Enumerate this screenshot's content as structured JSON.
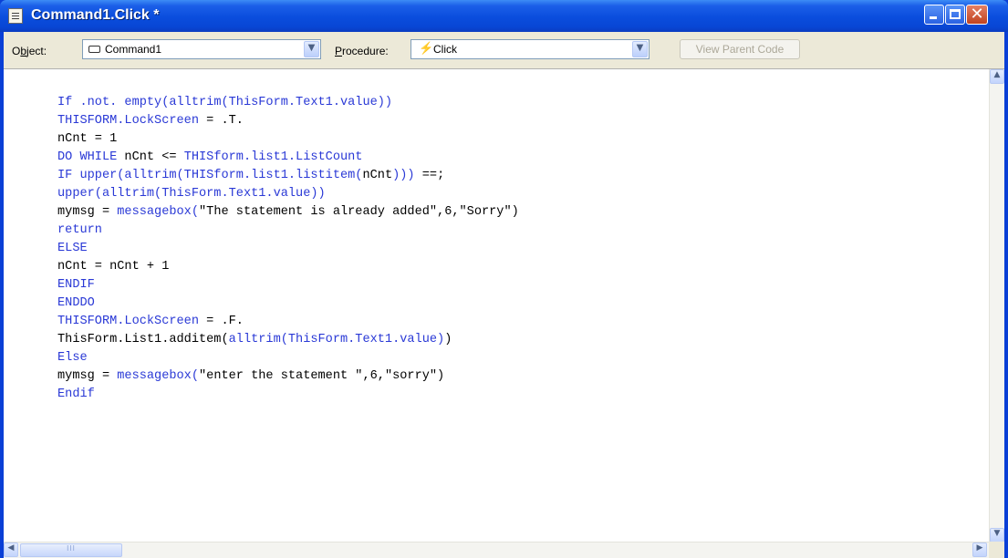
{
  "window": {
    "title": "Command1.Click *",
    "controls": [
      "minimize-icon",
      "maximize-icon",
      "close-icon"
    ],
    "close_glyph": "✕"
  },
  "toolbar": {
    "object_label_prefix": "O",
    "object_label_underlined": "b",
    "object_label_suffix": "ject:",
    "object_value": "Command1",
    "procedure_label_underlined": "P",
    "procedure_label_suffix": "rocedure:",
    "procedure_value": "Click",
    "view_parent_label": "View Parent Code",
    "dropdown_glyph": "▼"
  },
  "code": {
    "lines": [
      [
        {
          "t": "If .not. ",
          "c": "kw"
        },
        {
          "t": "empty(alltrim(ThisForm.Text1.value))",
          "c": "kw"
        }
      ],
      [
        {
          "t": "THISFORM.LockScreen",
          "c": "kw"
        },
        {
          "t": " = .T.",
          "c": "tx"
        }
      ],
      [
        {
          "t": "nCnt = 1",
          "c": "tx"
        }
      ],
      [
        {
          "t": "DO WHILE",
          "c": "kw"
        },
        {
          "t": " nCnt <= ",
          "c": "tx"
        },
        {
          "t": "THISform.list1.ListCount",
          "c": "kw"
        }
      ],
      [
        {
          "t": "IF upper(alltrim(THISform.list1.listitem(",
          "c": "kw"
        },
        {
          "t": "nCnt",
          "c": "tx"
        },
        {
          "t": ")))",
          "c": "kw"
        },
        {
          "t": " ==;",
          "c": "tx"
        }
      ],
      [
        {
          "t": "upper(alltrim(ThisForm.Text1.value))",
          "c": "kw"
        }
      ],
      [
        {
          "t": "mymsg = ",
          "c": "tx"
        },
        {
          "t": "messagebox(",
          "c": "kw"
        },
        {
          "t": "\"The statement is already added\",6,\"Sorry\")",
          "c": "tx"
        }
      ],
      [
        {
          "t": "return",
          "c": "kw"
        }
      ],
      [
        {
          "t": "ELSE",
          "c": "kw"
        }
      ],
      [
        {
          "t": "nCnt = nCnt + 1",
          "c": "tx"
        }
      ],
      [
        {
          "t": "ENDIF",
          "c": "kw"
        }
      ],
      [
        {
          "t": "ENDDO",
          "c": "kw"
        }
      ],
      [
        {
          "t": "THISFORM.LockScreen",
          "c": "kw"
        },
        {
          "t": " = .F.",
          "c": "tx"
        }
      ],
      [
        {
          "t": "ThisForm.List1.additem(",
          "c": "tx"
        },
        {
          "t": "alltrim(ThisForm.Text1.value)",
          "c": "kw"
        },
        {
          "t": ")",
          "c": "tx"
        }
      ],
      [
        {
          "t": "Else",
          "c": "kw"
        }
      ],
      [
        {
          "t": "mymsg = ",
          "c": "tx"
        },
        {
          "t": "messagebox(",
          "c": "kw"
        },
        {
          "t": "\"enter the statement \",6,\"sorry\")",
          "c": "tx"
        }
      ],
      [
        {
          "t": "Endif",
          "c": "kw"
        }
      ]
    ]
  },
  "scrollbars": {
    "up_glyph": "▲",
    "down_glyph": "▼",
    "left_glyph": "◀",
    "right_glyph": "▶",
    "thumb_grip": "III"
  },
  "colors": {
    "keyword": "#2a39d6",
    "text": "#000000",
    "titlebar": "#0a4ddd"
  }
}
